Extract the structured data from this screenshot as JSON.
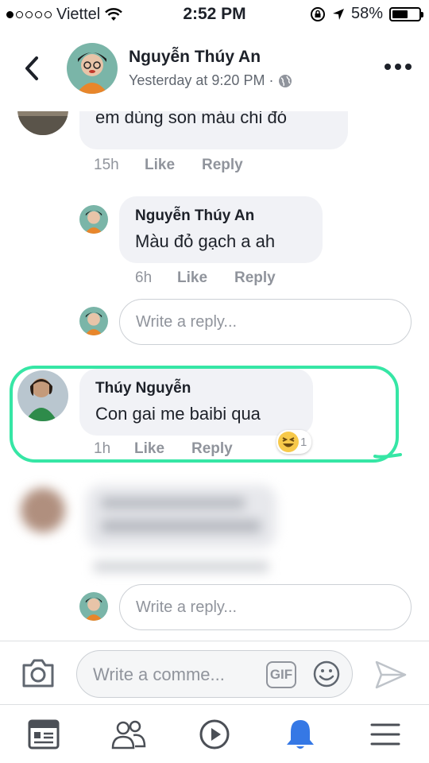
{
  "status_bar": {
    "carrier": "Viettel",
    "time": "2:52 PM",
    "battery_text": "58%",
    "battery_level": 0.58
  },
  "header": {
    "name": "Nguyễn Thúy An",
    "meta": "Yesterday at 9:20 PM ·"
  },
  "comments": [
    {
      "text": "em dùng son màu chi đó",
      "time": "15h",
      "like": "Like",
      "reply": "Reply"
    },
    {
      "name": "Nguyễn Thúy An",
      "text": "Màu đỏ gạch a ah",
      "time": "6h",
      "like": "Like",
      "reply": "Reply"
    },
    {
      "name": "Thúy Nguyễn",
      "text": "Con gai me baibi qua",
      "time": "1h",
      "like": "Like",
      "reply": "Reply",
      "reaction_count": "1"
    }
  ],
  "reply_placeholder": "Write a reply...",
  "comment_placeholder": "Write a comme...",
  "gif_label": "GIF",
  "colors": {
    "highlight": "#36e6a5",
    "fb_blue": "#4267b2",
    "notification_blue": "#3578e5",
    "gray_text": "#90949c"
  }
}
